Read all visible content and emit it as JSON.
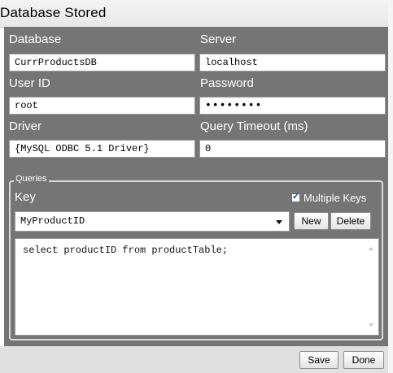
{
  "window": {
    "title": "Database Stored"
  },
  "connection": {
    "database_label": "Database",
    "database_value": "CurrProductsDB",
    "server_label": "Server",
    "server_value": "localhost",
    "userid_label": "User ID",
    "userid_value": "root",
    "password_label": "Password",
    "password_value": "••••••••",
    "driver_label": "Driver",
    "driver_value": "{MySQL ODBC 5.1 Driver}",
    "timeout_label": "Query Timeout (ms)",
    "timeout_value": "0"
  },
  "queries": {
    "group_title": "Queries",
    "key_label": "Key",
    "multiple_keys_label": "Multiple Keys",
    "multiple_keys_checked": true,
    "key_selected": "MyProductID",
    "new_label": "New",
    "delete_label": "Delete",
    "sql_text": "select productID from productTable;"
  },
  "footer": {
    "save_label": "Save",
    "done_label": "Done"
  },
  "colors": {
    "panel_bg": "#757575",
    "label_text": "#ffffff",
    "checkbox_mark": "#1b3fa8"
  },
  "icons": {
    "combo_arrow": "chevron-down-icon",
    "checkbox_mark": "check-icon",
    "scroll_up": "scroll-up-arrow-icon",
    "scroll_down": "scroll-down-arrow-icon"
  }
}
